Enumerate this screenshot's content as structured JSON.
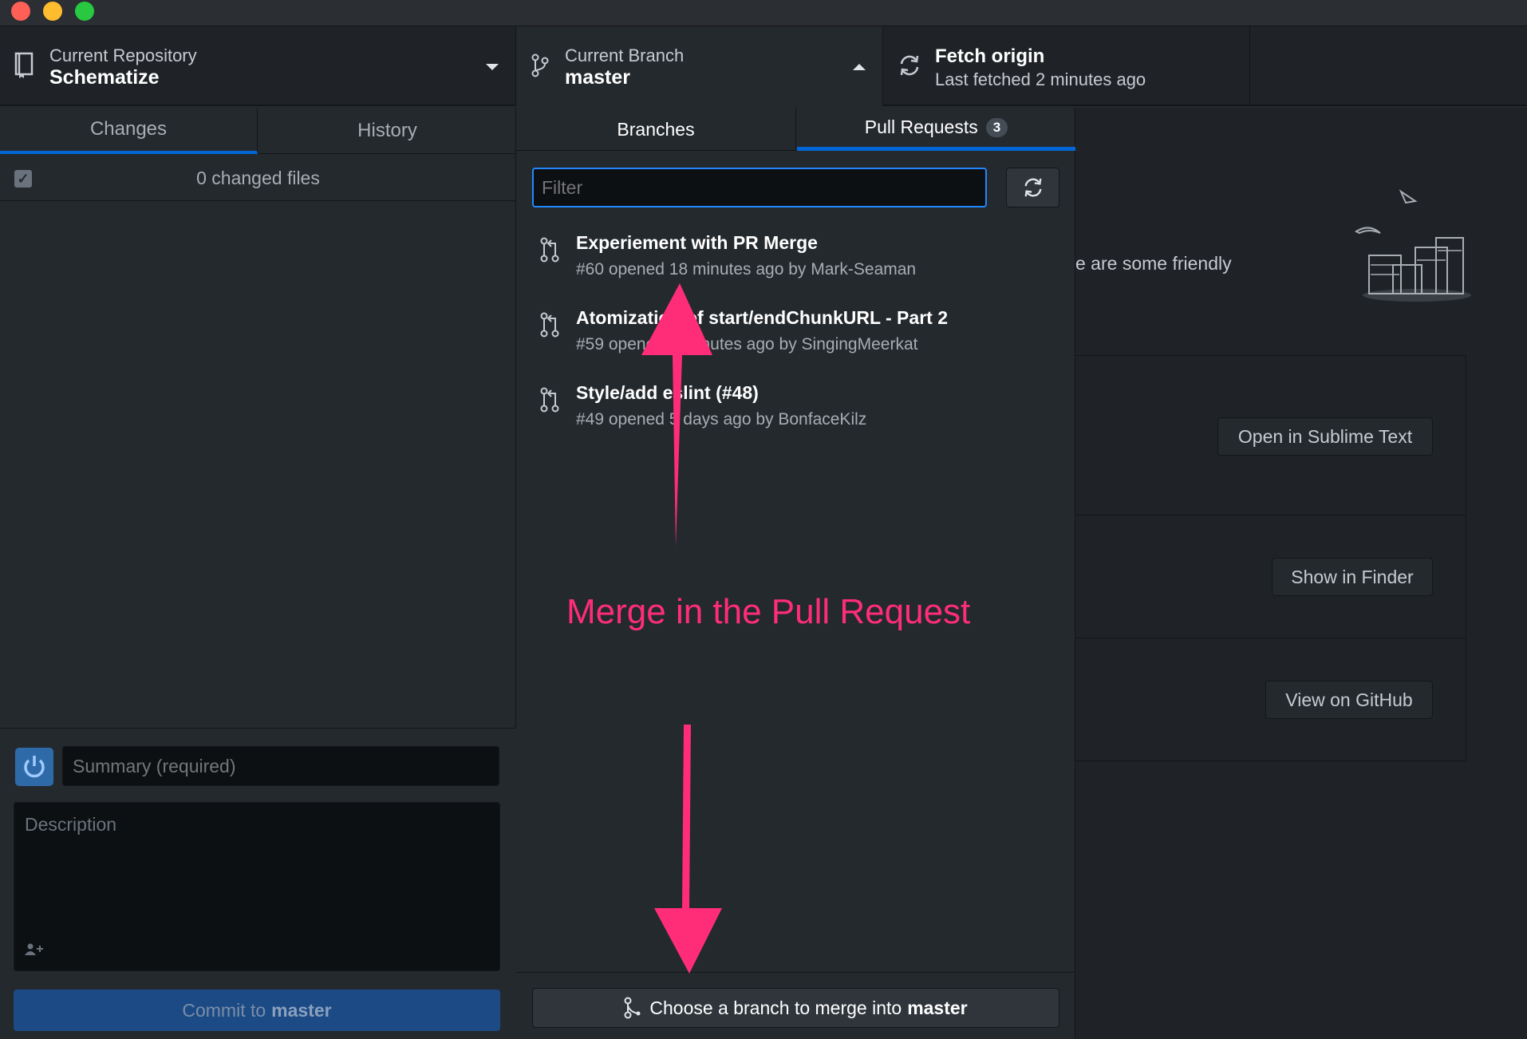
{
  "toolbar": {
    "repo": {
      "label": "Current Repository",
      "value": "Schematize",
      "icon": "repo-icon"
    },
    "branch": {
      "label": "Current Branch",
      "value": "master",
      "icon": "branch-icon"
    },
    "fetch": {
      "title": "Fetch origin",
      "subtitle": "Last fetched 2 minutes ago",
      "icon": "sync-icon"
    }
  },
  "left_panel": {
    "tabs": [
      {
        "label": "Changes",
        "active": true
      },
      {
        "label": "History",
        "active": false
      }
    ],
    "changed_files": "0 changed files",
    "commit": {
      "summary_placeholder": "Summary (required)",
      "description_placeholder": "Description",
      "button_prefix": "Commit to",
      "button_branch": "master"
    }
  },
  "dropdown": {
    "tabs": {
      "branches": "Branches",
      "pull_requests": "Pull Requests",
      "pr_count": "3"
    },
    "filter_placeholder": "Filter",
    "pull_requests": [
      {
        "title": "Experiement with PR Merge",
        "subtitle": "#60 opened 18 minutes ago by Mark-Seaman"
      },
      {
        "title": "Atomization of start/endChunkURL - Part 2",
        "subtitle": "#59 opened 5 minutes ago by SingingMeerkat"
      },
      {
        "title": "Style/add eslint (#48)",
        "subtitle": "#49 opened 5 days ago by BonfaceKilz"
      }
    ],
    "merge_button": {
      "prefix": "Choose a branch to merge into",
      "branch": "master"
    }
  },
  "background": {
    "friendly_text": "e are some friendly",
    "buttons": {
      "sublime": "Open in Sublime Text",
      "finder": "Show in Finder",
      "github": "View on GitHub"
    }
  },
  "annotation": {
    "text": "Merge in the Pull Request",
    "color": "#ff2d78"
  },
  "colors": {
    "accent": "#0366d6",
    "focus": "#2188ff",
    "commit_button": "#1c4a85"
  }
}
